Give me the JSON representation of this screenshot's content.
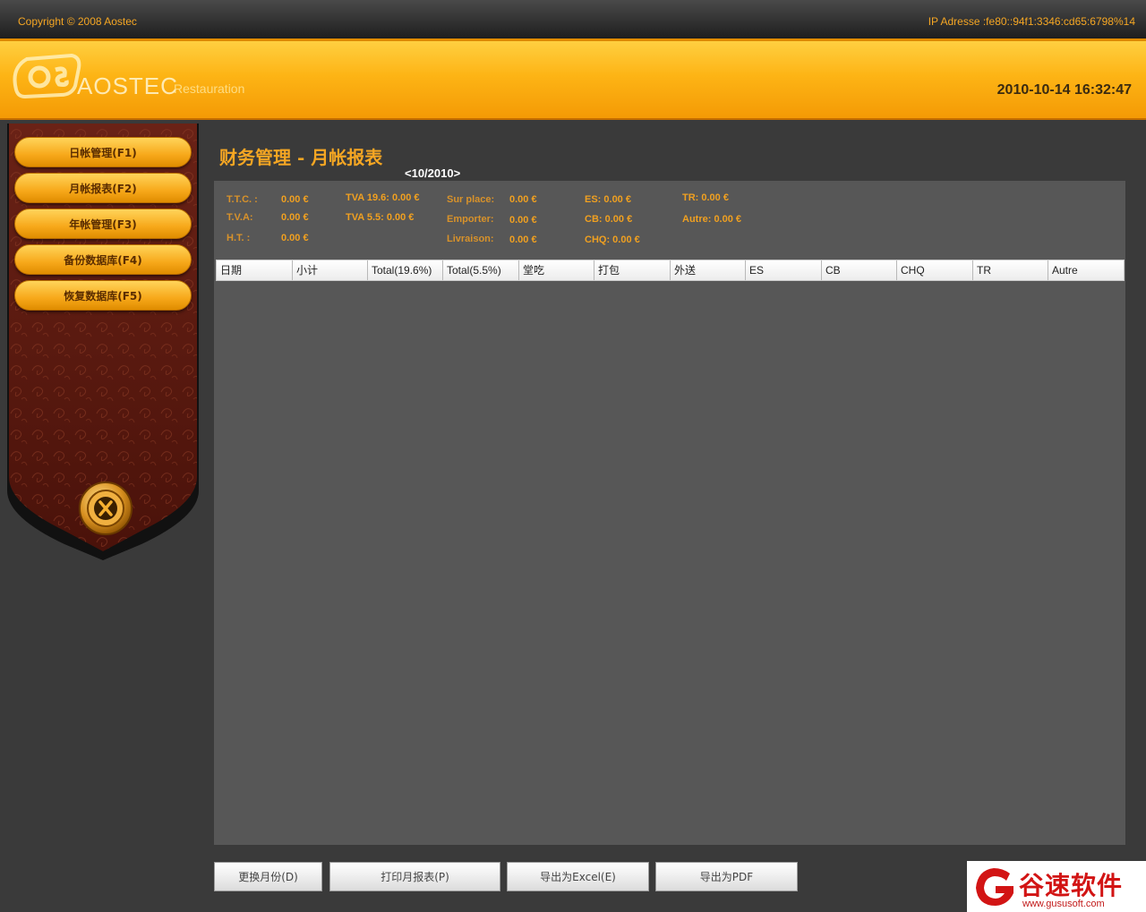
{
  "topbar": {
    "copyright": "Copyright © 2008 Aostec",
    "ip": "IP Adresse :fe80::94f1:3346:cd65:6798%14"
  },
  "header": {
    "logo_text": "AOSTEC",
    "logo_sub": "Restauration",
    "datetime": "2010-10-14 16:32:47"
  },
  "sidebar": {
    "items": [
      {
        "label": "日帐管理(F1)"
      },
      {
        "label": "月帐报表(F2)"
      },
      {
        "label": "年帐管理(F3)"
      },
      {
        "label": "备份数据库(F4)"
      },
      {
        "label": "恢复数据库(F5)"
      }
    ],
    "exit_icon": "exit-x-icon"
  },
  "main": {
    "title": "财务管理 - 月帐报表",
    "month": "<10/2010>",
    "summary": {
      "ttc_label": "T.T.C. :",
      "ttc_value": "0.00 €",
      "tva_label": "T.V.A:",
      "tva_value": "0.00 €",
      "ht_label": "H.T. :",
      "ht_value": "0.00 €",
      "tva196": "TVA 19.6: 0.00 €",
      "tva55": "TVA 5.5: 0.00 €",
      "surplace_label": "Sur place:",
      "surplace_value": "0.00 €",
      "emporter_label": "Emporter:",
      "emporter_value": "0.00 €",
      "livraison_label": "Livraison:",
      "livraison_value": "0.00 €",
      "es": "ES: 0.00 €",
      "cb": "CB: 0.00 €",
      "chq": "CHQ: 0.00 €",
      "tr": "TR: 0.00 €",
      "autre": "Autre: 0.00 €"
    },
    "columns": [
      "日期",
      "小计",
      "Total(19.6%)",
      "Total(5.5%)",
      "堂吃",
      "打包",
      "外送",
      "ES",
      "CB",
      "CHQ",
      "TR",
      "Autre"
    ]
  },
  "buttons": {
    "change_month": "更换月份(D)",
    "print_report": "打印月报表(P)",
    "export_excel": "导出为Excel(E)",
    "export_pdf": "导出为PDF"
  },
  "watermark": {
    "text": "谷速软件",
    "url": "www.gususoft.com"
  },
  "colors": {
    "accent": "#f5a623",
    "header_orange": "#fdb415",
    "panel": "#575757",
    "sidebar_dark": "#5a1a10"
  }
}
